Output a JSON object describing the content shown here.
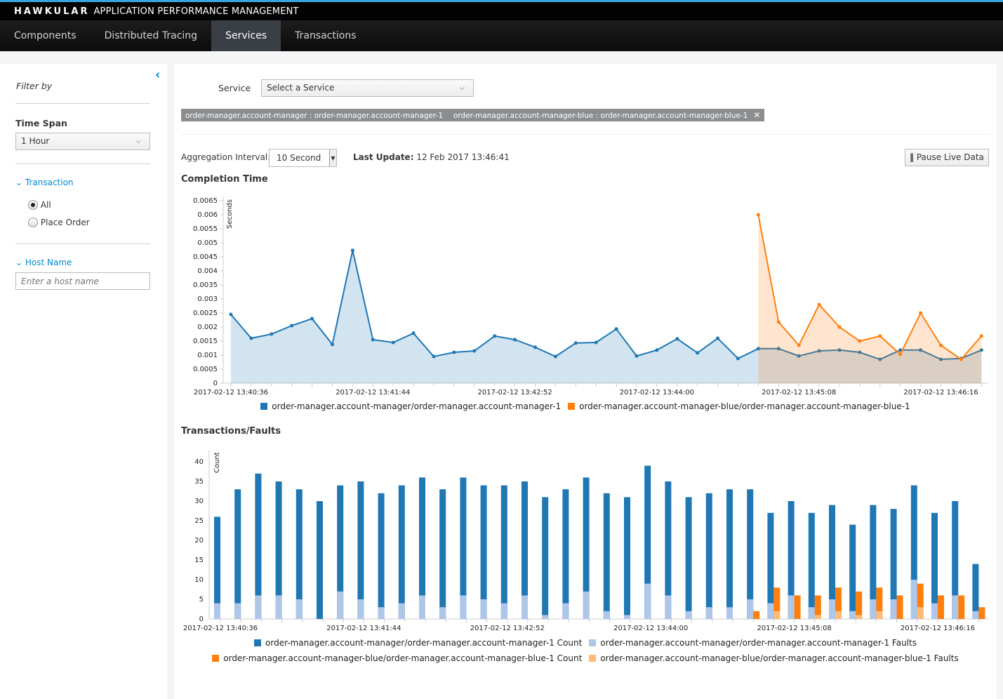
{
  "app": {
    "brand": "HAWKULAR",
    "title": "APPLICATION PERFORMANCE MANAGEMENT"
  },
  "nav": {
    "items": [
      {
        "label": "Components"
      },
      {
        "label": "Distributed Tracing"
      },
      {
        "label": "Services",
        "active": true
      },
      {
        "label": "Transactions"
      }
    ]
  },
  "sidebar": {
    "filter_by": "Filter by",
    "time_span_label": "Time Span",
    "time_span_value": "1 Hour",
    "transaction_label": "Transaction",
    "transaction_options": [
      {
        "label": "All",
        "checked": true
      },
      {
        "label": "Place Order",
        "checked": false
      }
    ],
    "host_label": "Host Name",
    "host_placeholder": "Enter a host name"
  },
  "main": {
    "service_label": "Service",
    "service_placeholder": "Select a Service",
    "tags": [
      "order-manager.account-manager : order-manager.account-manager-1",
      "order-manager.account-manager-blue : order-manager.account-manager-blue-1"
    ],
    "aggregation_label": "Aggregation Interval:",
    "aggregation_value": "10 Second",
    "last_update_label": "Last Update:",
    "last_update_value": "12 Feb 2017 13:46:41",
    "pause_label": "Pause Live Data"
  },
  "colors": {
    "accent": "#0088ce",
    "series1": "#1f77b4",
    "series1_faults": "#aec7e8",
    "series2": "#ff7f0e",
    "series2_faults": "#ffbb78"
  },
  "chart_data": [
    {
      "type": "area",
      "title": "Completion Time",
      "ylabel": "Seconds",
      "ylim": [
        0,
        0.0065
      ],
      "yticks": [
        "0",
        "0.0005",
        "0.001",
        "0.0015",
        "0.002",
        "0.0025",
        "0.003",
        "0.0035",
        "0.004",
        "0.0045",
        "0.005",
        "0.0055",
        "0.006",
        "0.0065"
      ],
      "x_tick_labels": [
        {
          "index": 0,
          "label": "2017-02-12 13:40:36"
        },
        {
          "index": 7,
          "label": "2017-02-12 13:41:44"
        },
        {
          "index": 14,
          "label": "2017-02-12 13:42:52"
        },
        {
          "index": 21,
          "label": "2017-02-12 13:44:00"
        },
        {
          "index": 28,
          "label": "2017-02-12 13:45:08"
        },
        {
          "index": 35,
          "label": "2017-02-12 13:46:16"
        }
      ],
      "series": [
        {
          "name": "order-manager.account-manager/order-manager.account-manager-1",
          "start_index": 0,
          "values": [
            0.00245,
            0.0016,
            0.00175,
            0.00205,
            0.0023,
            0.00138,
            0.00473,
            0.00155,
            0.00145,
            0.00178,
            0.00095,
            0.0011,
            0.00115,
            0.00168,
            0.00155,
            0.00128,
            0.00095,
            0.00143,
            0.00145,
            0.00193,
            0.00097,
            0.00118,
            0.00158,
            0.00108,
            0.0016,
            0.00088,
            0.00123,
            0.00123,
            0.00097,
            0.00115,
            0.00118,
            0.0011,
            0.00085,
            0.00118,
            0.00118,
            0.00085,
            0.00088,
            0.00118
          ]
        },
        {
          "name": "order-manager.account-manager-blue/order-manager.account-manager-blue-1",
          "start_index": 26,
          "values": [
            0.006,
            0.00218,
            0.00135,
            0.0028,
            0.002,
            0.0015,
            0.00168,
            0.00103,
            0.0025,
            0.00135,
            0.00085,
            0.00168
          ]
        }
      ]
    },
    {
      "type": "bar",
      "title": "Transactions/Faults",
      "ylabel": "Count",
      "ylim": [
        0,
        40
      ],
      "yticks": [
        "0",
        "5",
        "10",
        "15",
        "20",
        "25",
        "30",
        "35",
        "40"
      ],
      "x_tick_labels": [
        {
          "index": 0,
          "label": "2017-02-12 13:40:36"
        },
        {
          "index": 7,
          "label": "2017-02-12 13:41:44"
        },
        {
          "index": 14,
          "label": "2017-02-12 13:42:52"
        },
        {
          "index": 21,
          "label": "2017-02-12 13:44:00"
        },
        {
          "index": 28,
          "label": "2017-02-12 13:45:08"
        },
        {
          "index": 35,
          "label": "2017-02-12 13:46:16"
        }
      ],
      "series": [
        {
          "name": "order-manager.account-manager/order-manager.account-manager-1 Count",
          "start_index": 0,
          "values": [
            26,
            33,
            37,
            35,
            33,
            30,
            34,
            35,
            32,
            34,
            36,
            33,
            36,
            34,
            34,
            35,
            31,
            33,
            36,
            32,
            31,
            39,
            35,
            31,
            32,
            33,
            33,
            27,
            30,
            27,
            29,
            24,
            29,
            28,
            34,
            27,
            30,
            14
          ]
        },
        {
          "name": "order-manager.account-manager/order-manager.account-manager-1 Faults",
          "start_index": 0,
          "values": [
            4,
            4,
            6,
            6,
            5,
            0,
            7,
            5,
            3,
            4,
            6,
            3,
            6,
            5,
            4,
            6,
            1,
            4,
            7,
            2,
            1,
            9,
            6,
            2,
            3,
            3,
            5,
            4,
            6,
            3,
            5,
            2,
            5,
            5,
            10,
            4,
            6,
            2
          ]
        },
        {
          "name": "order-manager.account-manager-blue/order-manager.account-manager-blue-1 Count",
          "start_index": 26,
          "values": [
            2,
            8,
            6,
            6,
            8,
            7,
            8,
            6,
            9,
            6,
            6,
            3
          ]
        },
        {
          "name": "order-manager.account-manager-blue/order-manager.account-manager-blue-1 Faults",
          "start_index": 26,
          "values": [
            0,
            2,
            0,
            1,
            2,
            1,
            2,
            0,
            3,
            0,
            0,
            0
          ]
        }
      ]
    }
  ]
}
